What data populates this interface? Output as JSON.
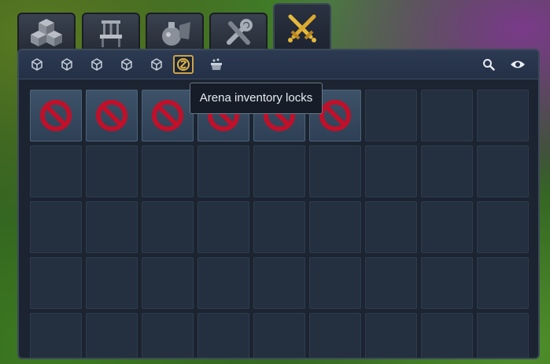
{
  "tabs": [
    {
      "icon": "cube-stack-icon",
      "active": false
    },
    {
      "icon": "chair-icon",
      "active": false
    },
    {
      "icon": "potion-icon",
      "active": false
    },
    {
      "icon": "tools-icon",
      "active": false
    },
    {
      "icon": "crossed-swords-icon",
      "active": true
    }
  ],
  "toolbar": {
    "filters": [
      {
        "icon": "cube-icon",
        "active": false
      },
      {
        "icon": "cube-icon",
        "active": false
      },
      {
        "icon": "cube-icon",
        "active": false
      },
      {
        "icon": "cube-icon",
        "active": false
      },
      {
        "icon": "cube-icon",
        "active": false
      },
      {
        "icon": "arena-swirl-icon",
        "active": true
      },
      {
        "icon": "basket-icon",
        "active": false
      }
    ],
    "right": [
      {
        "icon": "search-icon"
      },
      {
        "icon": "eye-icon"
      }
    ]
  },
  "tooltip": {
    "text": "Arena inventory locks"
  },
  "inventory": {
    "columns": 9,
    "rows": 5,
    "locked_slots": 6,
    "lock_icon": "no-entry-icon",
    "colors": {
      "lock": "#c0102a",
      "accent": "#c9a34a"
    }
  }
}
